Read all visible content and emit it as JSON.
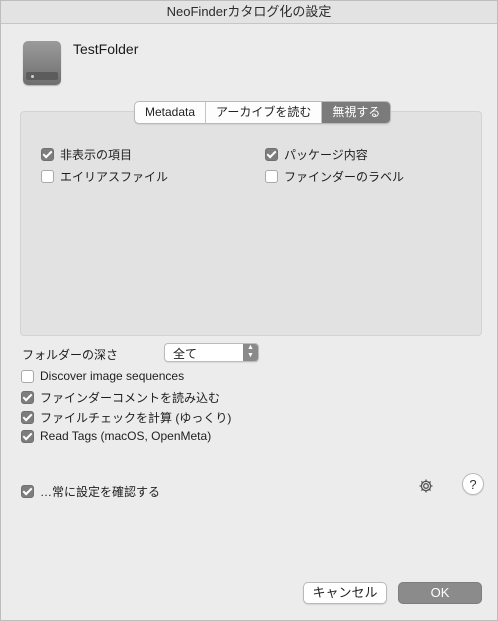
{
  "window": {
    "title": "NeoFinderカタログ化の設定"
  },
  "header": {
    "folder_name": "TestFolder",
    "icon": "external-drive-icon"
  },
  "tabs": [
    {
      "label": "Metadata",
      "active": false
    },
    {
      "label": "アーカイブを読む",
      "active": false
    },
    {
      "label": "無視する",
      "active": true
    }
  ],
  "ignore_panel": {
    "options": [
      {
        "label": "非表示の項目",
        "checked": true
      },
      {
        "label": "パッケージ内容",
        "checked": true
      },
      {
        "label": "エイリアスファイル",
        "checked": false
      },
      {
        "label": "ファインダーのラベル",
        "checked": false
      }
    ]
  },
  "folder_depth": {
    "label": "フォルダーの深さ",
    "value": "全て"
  },
  "options": [
    {
      "label": "Discover image sequences",
      "checked": false
    },
    {
      "label": "ファインダーコメントを読み込む",
      "checked": true
    },
    {
      "label": "ファイルチェックを計算 (ゆっくり)",
      "checked": true
    },
    {
      "label": "Read Tags (macOS, OpenMeta)",
      "checked": true
    }
  ],
  "always_confirm": {
    "label": "…常に設定を確認する",
    "checked": true
  },
  "icons": {
    "settings": "gear-icon",
    "help": "help-icon"
  },
  "help_label": "?",
  "buttons": {
    "cancel": "キャンセル",
    "ok": "OK"
  }
}
